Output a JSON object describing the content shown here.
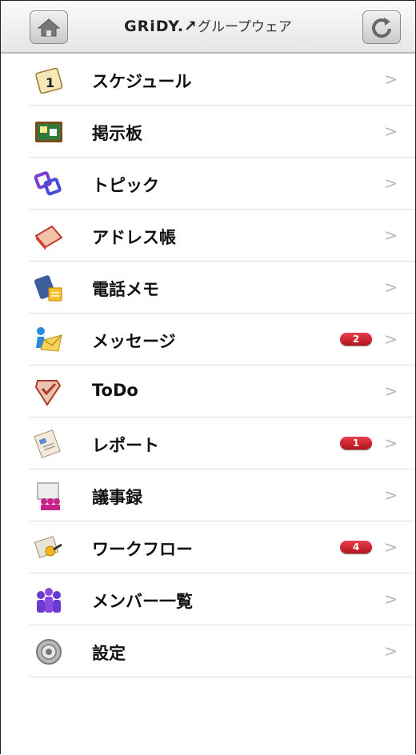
{
  "header": {
    "logo_mark": "GRiDY",
    "logo_sub": "グループウェア",
    "home_icon": "home-icon",
    "refresh_icon": "refresh-icon"
  },
  "menu": [
    {
      "label": "スケジュール",
      "icon": "calendar-icon",
      "badge": ""
    },
    {
      "label": "掲示板",
      "icon": "bulletin-board-icon",
      "badge": ""
    },
    {
      "label": "トピック",
      "icon": "topic-icon",
      "badge": ""
    },
    {
      "label": "アドレス帳",
      "icon": "address-book-icon",
      "badge": ""
    },
    {
      "label": "電話メモ",
      "icon": "phone-memo-icon",
      "badge": ""
    },
    {
      "label": "メッセージ",
      "icon": "message-icon",
      "badge": "2"
    },
    {
      "label": "ToDo",
      "icon": "todo-icon",
      "badge": ""
    },
    {
      "label": "レポート",
      "icon": "report-icon",
      "badge": "1"
    },
    {
      "label": "議事録",
      "icon": "minutes-icon",
      "badge": ""
    },
    {
      "label": "ワークフロー",
      "icon": "workflow-icon",
      "badge": "4"
    },
    {
      "label": "メンバー一覧",
      "icon": "members-icon",
      "badge": ""
    },
    {
      "label": "設定",
      "icon": "settings-icon",
      "badge": ""
    }
  ],
  "colors": {
    "badge": "#d0202a",
    "chevron": "#b5b5b5",
    "divider": "#dcdcdc"
  }
}
